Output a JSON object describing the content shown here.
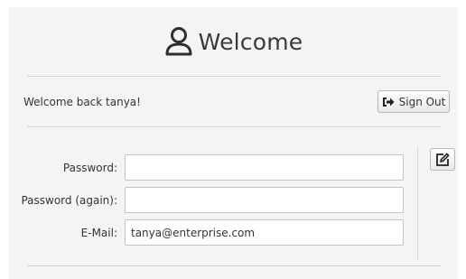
{
  "header": {
    "title": "Welcome",
    "icon": "user-icon"
  },
  "session": {
    "welcome_message": "Welcome back tanya!",
    "sign_out_label": "Sign Out",
    "sign_out_icon": "sign-out-icon"
  },
  "form": {
    "password_label": "Password:",
    "password_value": "",
    "password_again_label": "Password (again):",
    "password_again_value": "",
    "email_label": "E-Mail:",
    "email_value": "tanya@enterprise.com",
    "edit_icon": "edit-icon"
  }
}
